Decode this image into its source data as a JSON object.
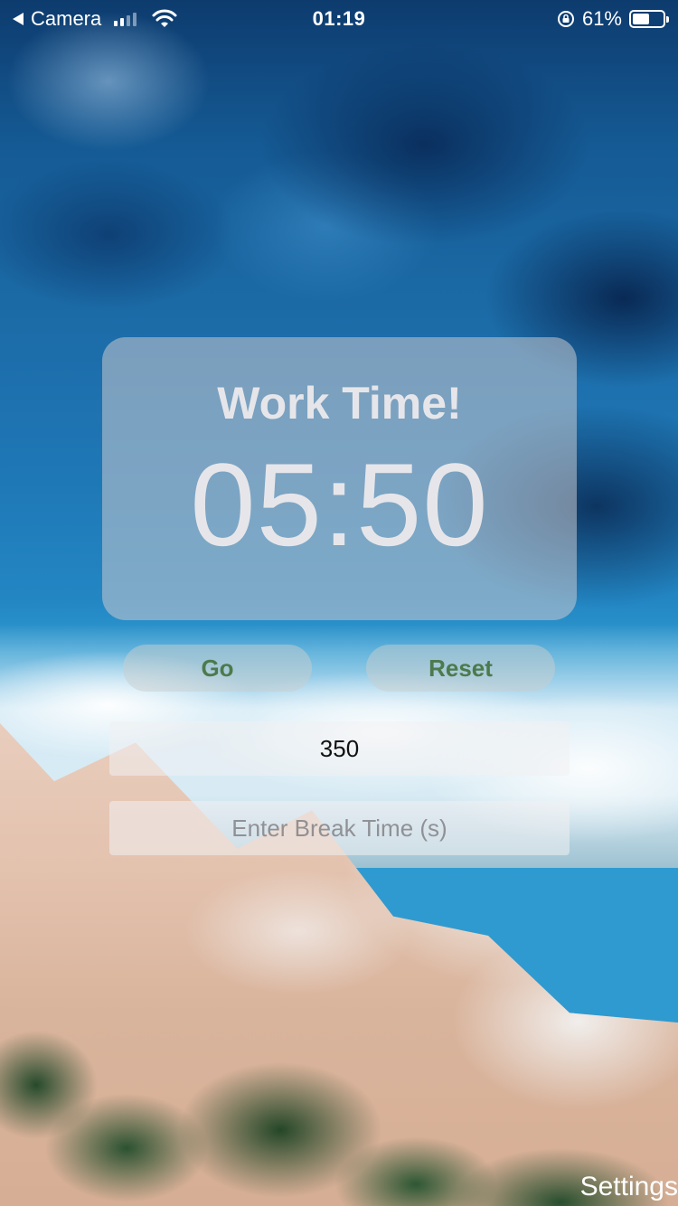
{
  "status_bar": {
    "back_label": "Camera",
    "time": "01:19",
    "battery": "61%",
    "battery_level": 0.61
  },
  "timer": {
    "title": "Work Time!",
    "value": "05:50"
  },
  "controls": {
    "go_label": "Go",
    "reset_label": "Reset"
  },
  "inputs": {
    "work_time_value": "350",
    "break_time_placeholder": "Enter Break Time (s)"
  },
  "footer": {
    "settings_label": "Settings"
  },
  "colors": {
    "button_text": "#4d7a4d",
    "card_bg": "rgba(200,200,205,0.55)",
    "timer_text": "#e6e6ea"
  }
}
